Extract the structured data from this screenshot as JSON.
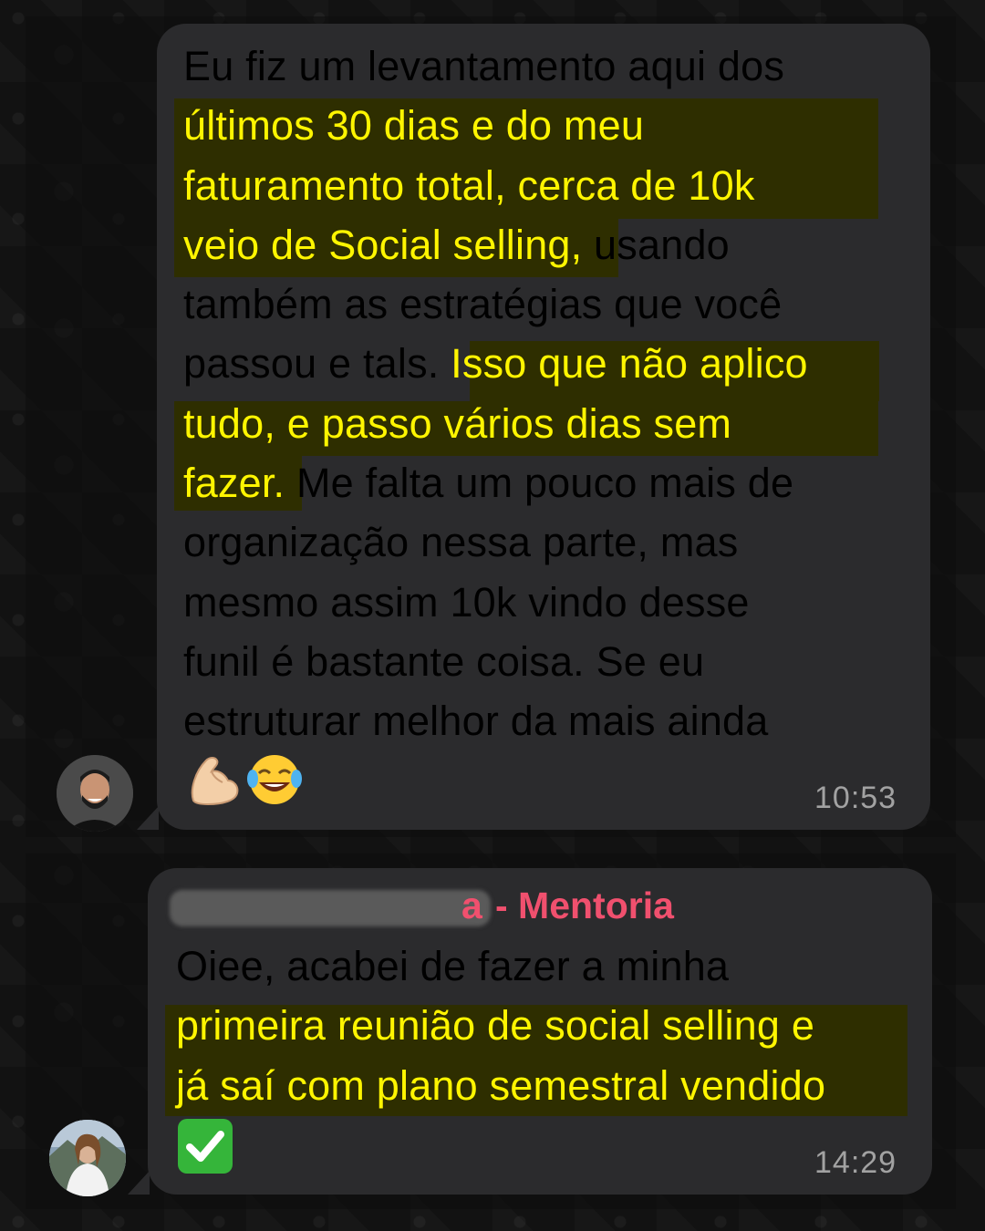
{
  "messages": [
    {
      "lines": [
        "Eu fiz um levantamento aqui dos",
        "últimos 30 dias e do meu",
        "faturamento total, cerca de 10k",
        "veio de Social selling,",
        " usando",
        "também as estratégias que você",
        "passou e tals. ",
        "Isso que não aplico",
        "tudo, e passo vários dias sem",
        "fazer.",
        " Me falta um pouco mais de",
        "organização nessa parte, mas",
        "mesmo assim 10k vindo desse",
        "funil é bastante coisa. Se eu",
        "estruturar melhor da mais ainda"
      ],
      "emojis": [
        "💪",
        "😂"
      ],
      "time": "10:53",
      "avatar_icon": "man-avatar-photo"
    },
    {
      "sender_suffix": "- Mentoria",
      "sender_partial": "a",
      "lines": [
        "Oiee, acabei de fazer a minha",
        "primeira reunião de social selling e",
        "já saí com plano semestral vendido"
      ],
      "emojis": [
        "✅"
      ],
      "time": "14:29",
      "avatar_icon": "woman-avatar-photo"
    }
  ],
  "colors": {
    "bubble": "#2b2b2d",
    "highlight_text": "#fff500",
    "highlight_bg": "#2f2f00",
    "sender": "#f0506e",
    "time": "#a2a2a2"
  }
}
